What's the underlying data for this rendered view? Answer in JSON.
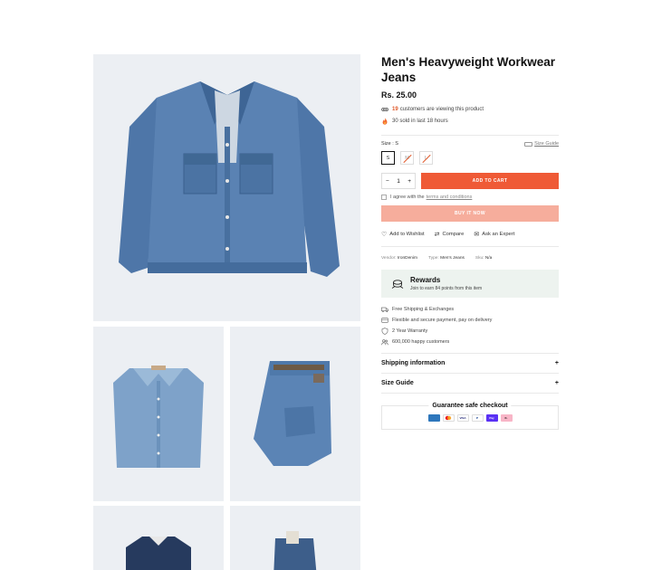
{
  "product": {
    "title": "Men's Heavyweight Workwear Jeans",
    "price": "Rs. 25.00",
    "viewers_count": "19",
    "viewers_text": "customers are viewing this product",
    "sold_text": "30 sold in last 18 hours"
  },
  "size": {
    "label": "Size : S",
    "guide_label": "Size Guide",
    "options": [
      "S",
      "M",
      "L"
    ]
  },
  "cart": {
    "quantity": "1",
    "minus": "−",
    "plus": "+",
    "add_label": "ADD TO CART",
    "agree_text": "I agree with the",
    "terms_link": "terms and conditions",
    "buy_now_label": "BUY IT NOW"
  },
  "actions": {
    "wishlist": "Add to Wishlist",
    "compare": "Compare",
    "expert": "Ask an Expert"
  },
  "specs": {
    "vendor_label": "Vendor:",
    "vendor": "IronDenim",
    "type_label": "Type:",
    "type": "Men's Jeans",
    "sku_label": "Sku:",
    "sku": "N/a"
  },
  "rewards": {
    "title": "Rewards",
    "subtitle": "Join to earn 84 points from this item"
  },
  "perks": [
    "Free Shipping & Exchanges",
    "Flexible and secure payment, pay on delivery",
    "2 Year Warranty",
    "600,000 happy customers"
  ],
  "accordions": {
    "shipping": "Shipping information",
    "size_guide": "Size Guide",
    "toggle": "+"
  },
  "guarantee": {
    "title": "Guarantee safe checkout",
    "payments": [
      {
        "name": "amex-icon",
        "color": "#2e77bc"
      },
      {
        "name": "mastercard-icon",
        "color": "#ffffff"
      },
      {
        "name": "visa-icon",
        "color": "#ffffff"
      },
      {
        "name": "paypal-icon",
        "color": "#ffffff"
      },
      {
        "name": "gpay-icon",
        "color": "#5a31f4"
      },
      {
        "name": "klarna-icon",
        "color": "#f8b5c7"
      }
    ]
  },
  "colors": {
    "accent": "#ef5a36",
    "accent_light": "#f6ad9c",
    "image_bg": "#eceff3",
    "rewards_bg": "#edf3ef"
  }
}
